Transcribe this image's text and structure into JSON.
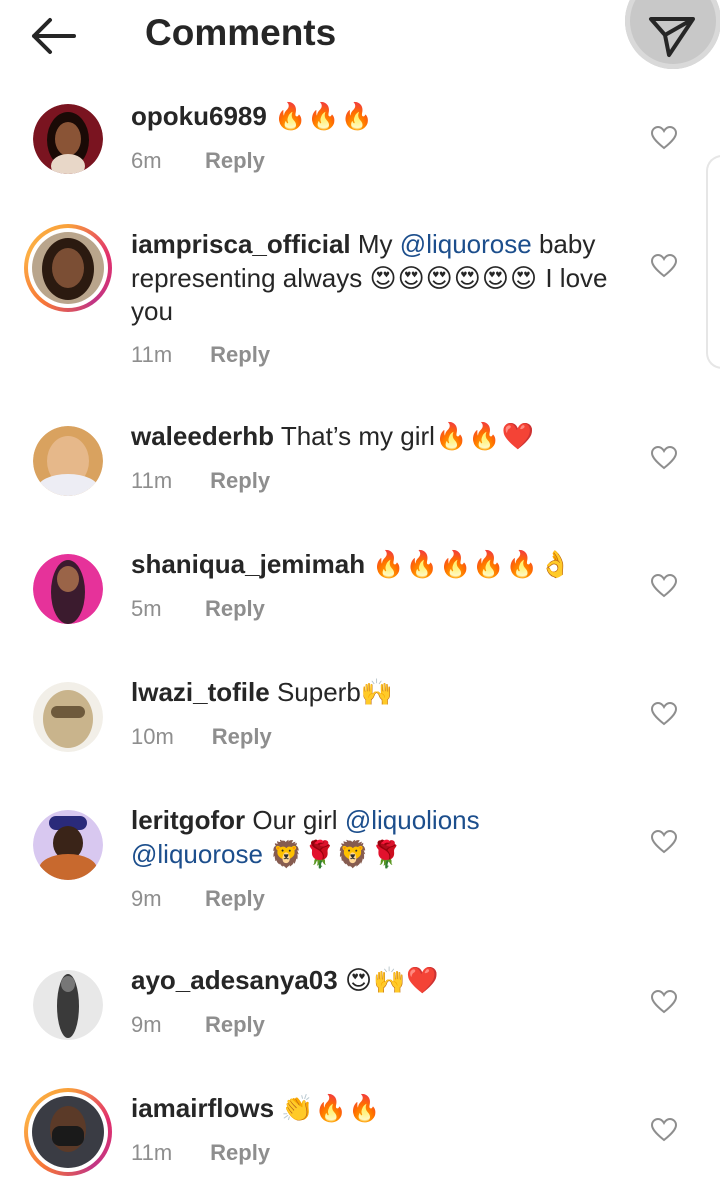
{
  "header": {
    "title": "Comments"
  },
  "comments": [
    {
      "username": "opoku6989",
      "text": "",
      "mentions": [],
      "emojis": "🔥🔥🔥",
      "time": "6m",
      "reply": "Reply"
    },
    {
      "username": "iamprisca_official",
      "text_before": "My",
      "mention": "@liquorose",
      "text_after": "baby representing always",
      "emojis": "😍😍😍😍😍😍",
      "text_end": "I love you",
      "time": "11m",
      "reply": "Reply"
    },
    {
      "username": "waleederhb",
      "text": "That’s my girl",
      "emojis": "🔥🔥❤️",
      "time": "11m",
      "reply": "Reply"
    },
    {
      "username": "shaniqua_jemimah",
      "text": "",
      "emojis": "🔥🔥🔥🔥🔥👌",
      "time": "5m",
      "reply": "Reply"
    },
    {
      "username": "lwazi_tofile",
      "text": "Superb",
      "emojis": "🙌",
      "time": "10m",
      "reply": "Reply"
    },
    {
      "username": "leritgofor",
      "text": "Our girl",
      "mention1": "@liquolions",
      "mention2": "@liquorose",
      "emojis": "🦁🌹🦁🌹",
      "time": "9m",
      "reply": "Reply"
    },
    {
      "username": "ayo_adesanya03",
      "text": "",
      "emojis": "😍🙌❤️",
      "time": "9m",
      "reply": "Reply"
    },
    {
      "username": "iamairflows",
      "text": "",
      "emojis": "👏🔥🔥",
      "time": "11m",
      "reply": "Reply"
    }
  ]
}
